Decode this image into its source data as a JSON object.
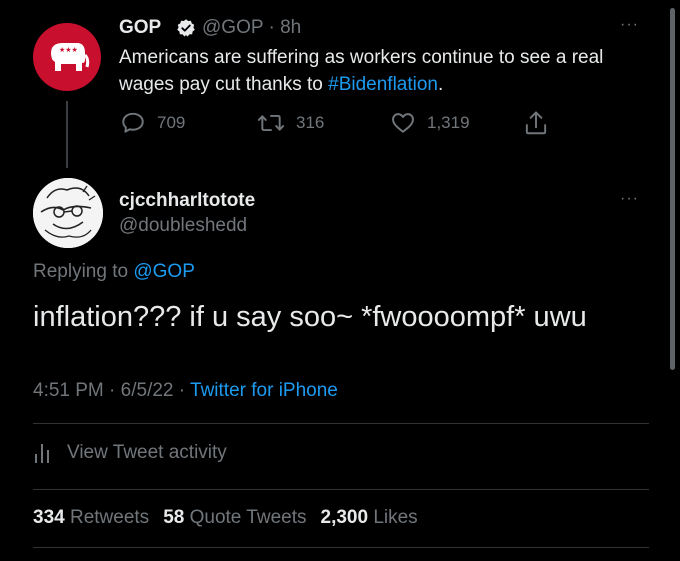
{
  "parent_tweet": {
    "author_name": "GOP",
    "handle": "@GOP",
    "time": "· 8h",
    "text_before": "Americans are suffering as workers continue to see a real wages pay cut thanks to ",
    "hashtag": "#Bidenflation",
    "text_after": ".",
    "avatar_icon": "republican-elephant-logo",
    "reply_count": "709",
    "retweet_count": "316",
    "like_count": "1,319",
    "more_label": "···"
  },
  "reply_tweet": {
    "author_name": "cjcchharltotote",
    "handle": "@doubleshedd",
    "replying_prefix": "Replying to ",
    "replying_to": "@GOP",
    "text": "inflation??? if u say soo~ *fwoooompf* uwu",
    "time": "4:51 PM",
    "sep1": "·",
    "date": "6/5/22",
    "sep2": "·",
    "source": "Twitter for iPhone",
    "more_label": "···",
    "avatar_icon": "sketch-avatar"
  },
  "activity": {
    "label": "View Tweet activity",
    "icon": "bar-chart-icon"
  },
  "stats": {
    "retweets_count": "334",
    "retweets_label": "Retweets",
    "quotes_count": "58",
    "quotes_label": "Quote Tweets",
    "likes_count": "2,300",
    "likes_label": "Likes"
  },
  "colors": {
    "background": "#000000",
    "text": "#e7e9ea",
    "muted": "#71767b",
    "link": "#1d9bf0",
    "gop_red": "#c8102e"
  }
}
